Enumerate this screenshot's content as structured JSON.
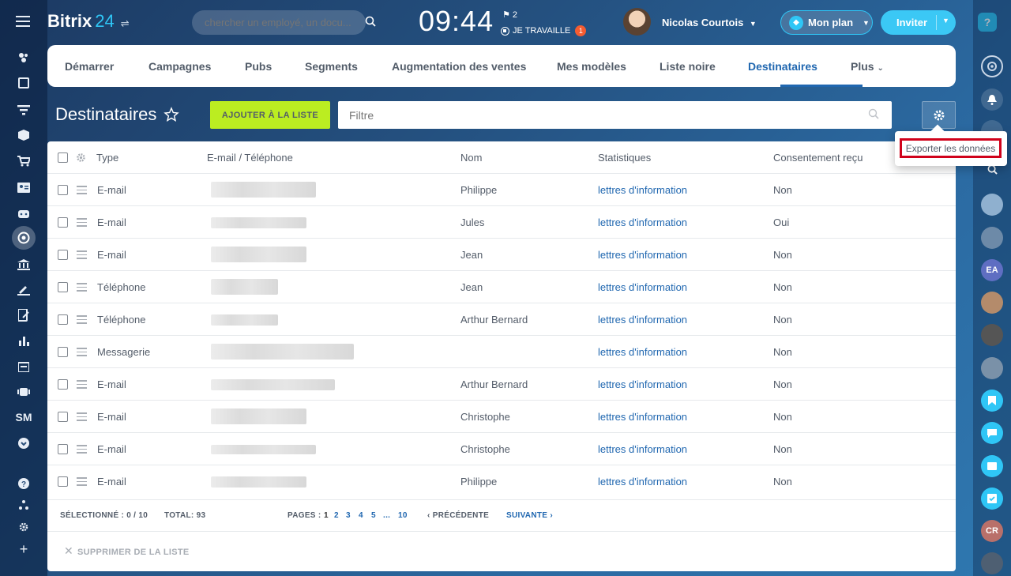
{
  "header": {
    "logo_name": "Bitrix",
    "logo_num": "24",
    "search_placeholder": "chercher un employé, un docu...",
    "clock": "09:44",
    "flag_count": "2",
    "work_status": "JE TRAVAILLE",
    "work_badge": "1",
    "user_name": "Nicolas Courtois",
    "plan_label": "Mon plan",
    "invite_label": "Inviter",
    "help_label": "?"
  },
  "tabs": [
    {
      "label": "Démarrer"
    },
    {
      "label": "Campagnes"
    },
    {
      "label": "Pubs"
    },
    {
      "label": "Segments"
    },
    {
      "label": "Augmentation des ventes"
    },
    {
      "label": "Mes modèles"
    },
    {
      "label": "Liste noire"
    },
    {
      "label": "Destinataires"
    },
    {
      "label": "Plus"
    }
  ],
  "page": {
    "title": "Destinataires",
    "add_button": "AJOUTER À LA LISTE",
    "filter_placeholder": "Filtre"
  },
  "popup": {
    "item": "Exporter les données"
  },
  "grid": {
    "columns": [
      "Type",
      "E-mail / Téléphone",
      "Nom",
      "Statistiques",
      "Consentement reçu"
    ],
    "rows": [
      {
        "type": "E-mail",
        "nom": "Philippe",
        "stats": "lettres d'information",
        "consent": "Non"
      },
      {
        "type": "E-mail",
        "nom": "Jules",
        "stats": "lettres d'information",
        "consent": "Oui"
      },
      {
        "type": "E-mail",
        "nom": "Jean",
        "stats": "lettres d'information",
        "consent": "Non"
      },
      {
        "type": "Téléphone",
        "nom": "Jean",
        "stats": "lettres d'information",
        "consent": "Non"
      },
      {
        "type": "Téléphone",
        "nom": "Arthur Bernard",
        "stats": "lettres d'information",
        "consent": "Non"
      },
      {
        "type": "Messagerie",
        "nom": "",
        "stats": "lettres d'information",
        "consent": "Non"
      },
      {
        "type": "E-mail",
        "nom": "Arthur Bernard",
        "stats": "lettres d'information",
        "consent": "Non"
      },
      {
        "type": "E-mail",
        "nom": "Christophe",
        "stats": "lettres d'information",
        "consent": "Non"
      },
      {
        "type": "E-mail",
        "nom": "Christophe",
        "stats": "lettres d'information",
        "consent": "Non"
      },
      {
        "type": "E-mail",
        "nom": "Philippe",
        "stats": "lettres d'information",
        "consent": "Non"
      }
    ],
    "footer": {
      "selected_label": "SÉLECTIONNÉ :",
      "selected_value": "0 / 10",
      "total_label": "TOTAL:",
      "total_value": "93",
      "pages_label": "PAGES :",
      "pages": [
        "1",
        "2",
        "3",
        "4",
        "5",
        "...",
        "10"
      ],
      "prev": "PRÉCÉDENTE",
      "next": "SUIVANTE"
    },
    "delete_label": "SUPPRIMER DE LA LISTE"
  },
  "left_sidebar": {
    "sm_label": "SM"
  },
  "right_sidebar": {
    "ea_label": "EA",
    "cr_label": "CR"
  },
  "colors": {
    "accent": "#2067b0",
    "add_button": "#bbed21",
    "invite": "#3bc8f5",
    "highlight": "#d0021b"
  }
}
